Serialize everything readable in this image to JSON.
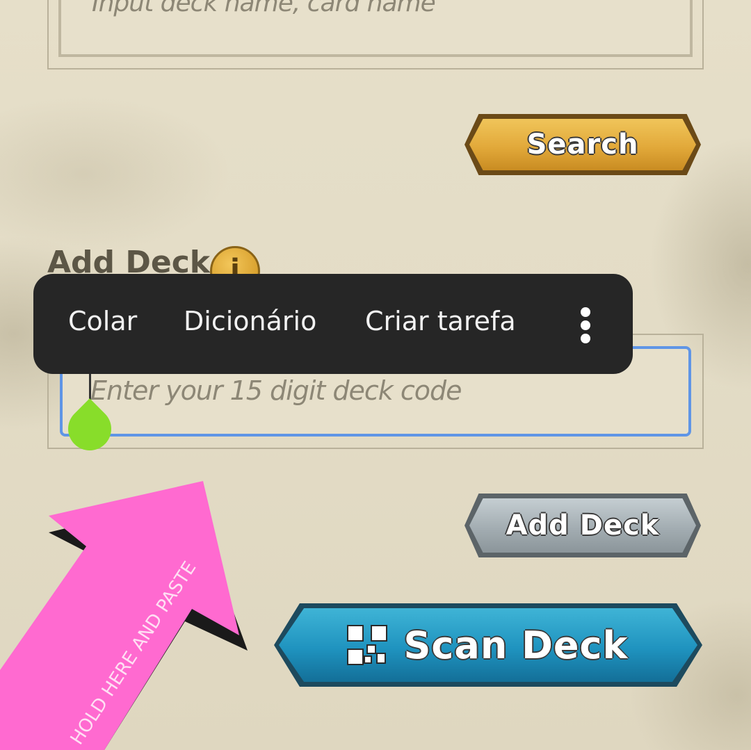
{
  "search": {
    "placeholder": "Input deck name, card name",
    "button_label": "Search"
  },
  "add_deck": {
    "title": "Add Deck",
    "info_icon": "info-icon",
    "info_glyph": "i",
    "code_placeholder": "Enter your 15 digit deck code",
    "add_button_label": "Add Deck",
    "scan_button_label": "Scan Deck",
    "scan_icon": "qr-code-icon"
  },
  "context_menu": {
    "items": [
      "Colar",
      "Dicionário",
      "Criar tarefa"
    ],
    "more_icon": "more-vertical-icon"
  },
  "annotation": {
    "text": "HOLD HERE AND PASTE",
    "arrow_color": "#ff6ad0"
  },
  "colors": {
    "search_button": "#e2a93a",
    "add_button": "#a3adb2",
    "scan_button": "#1f93bf",
    "focus_border": "#5f95e6",
    "selection_handle": "#88dd2a",
    "context_menu_bg": "#262626"
  }
}
